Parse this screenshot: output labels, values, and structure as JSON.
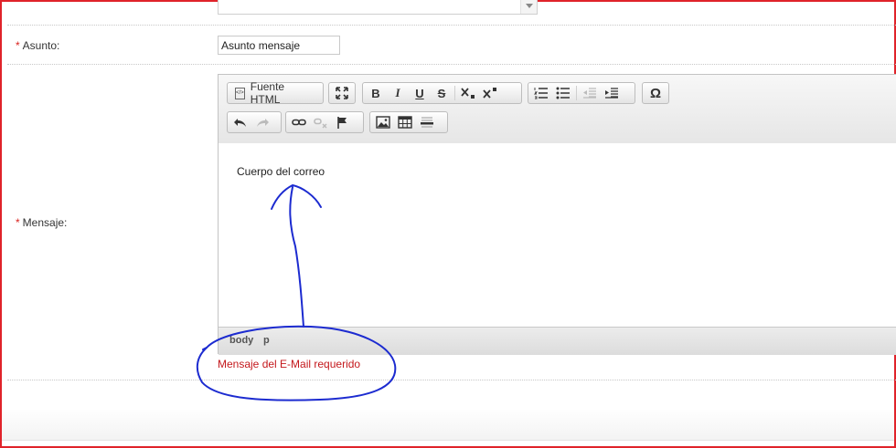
{
  "form": {
    "subject": {
      "required_mark": "*",
      "label": "Asunto:",
      "value": "Asunto mensaje"
    },
    "message": {
      "required_mark": "*",
      "label": "Mensaje:"
    },
    "error": "Mensaje del E-Mail requerido"
  },
  "editor": {
    "toolbar": {
      "source_label": "Fuente HTML",
      "bold": "B",
      "italic": "I",
      "underline": "U",
      "strike": "S",
      "omega": "Ω"
    },
    "content": "Cuerpo del correo",
    "path": [
      "body",
      "p"
    ]
  },
  "annotation": {
    "color": "#1c2bd0"
  }
}
